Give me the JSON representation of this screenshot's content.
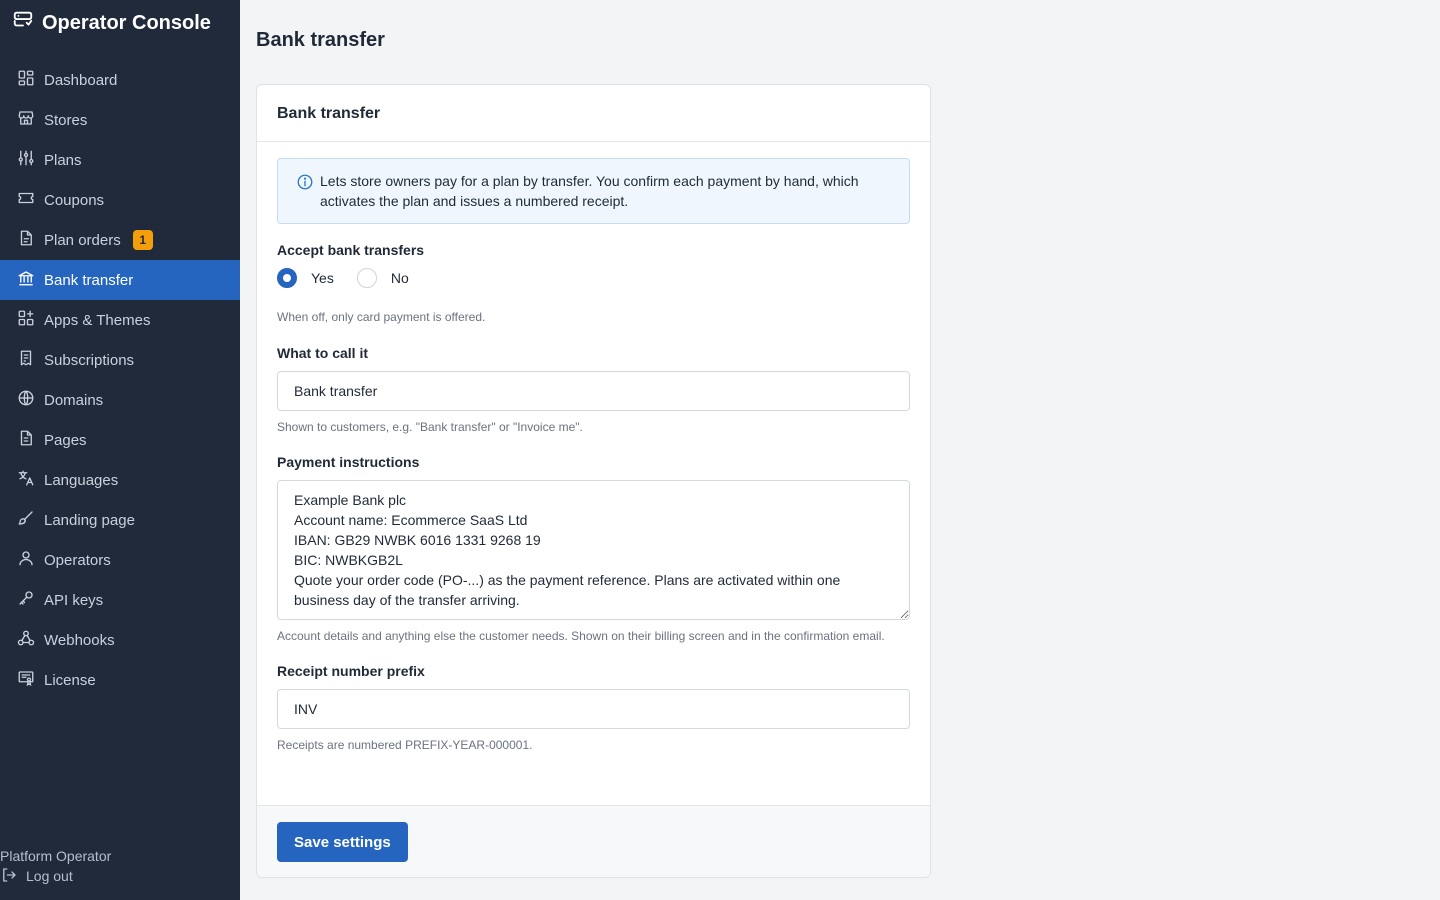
{
  "app": {
    "title": "Operator Console"
  },
  "sidebar": {
    "items": [
      {
        "label": "Dashboard",
        "icon": "dashboard-icon"
      },
      {
        "label": "Stores",
        "icon": "store-icon"
      },
      {
        "label": "Plans",
        "icon": "sliders-icon"
      },
      {
        "label": "Coupons",
        "icon": "ticket-icon"
      },
      {
        "label": "Plan orders",
        "icon": "document-icon",
        "badge": "1"
      },
      {
        "label": "Bank transfer",
        "icon": "bank-icon",
        "active": true
      },
      {
        "label": "Apps & Themes",
        "icon": "apps-icon"
      },
      {
        "label": "Subscriptions",
        "icon": "receipt-icon"
      },
      {
        "label": "Domains",
        "icon": "globe-icon"
      },
      {
        "label": "Pages",
        "icon": "page-icon"
      },
      {
        "label": "Languages",
        "icon": "language-icon"
      },
      {
        "label": "Landing page",
        "icon": "brush-icon"
      },
      {
        "label": "Operators",
        "icon": "user-icon"
      },
      {
        "label": "API keys",
        "icon": "key-icon"
      },
      {
        "label": "Webhooks",
        "icon": "webhook-icon"
      },
      {
        "label": "License",
        "icon": "certificate-icon"
      }
    ],
    "footer": {
      "operator_name": "Platform Operator",
      "logout_label": "Log out"
    }
  },
  "page": {
    "title": "Bank transfer"
  },
  "card": {
    "title": "Bank transfer",
    "info_text": "Lets store owners pay for a plan by transfer. You confirm each payment by hand, which activates the plan and issues a numbered receipt.",
    "accept": {
      "label": "Accept bank transfers",
      "options": [
        "Yes",
        "No"
      ],
      "selected": "Yes",
      "help": "When off, only card payment is offered."
    },
    "name_field": {
      "label": "What to call it",
      "value": "Bank transfer",
      "help": "Shown to customers, e.g. \"Bank transfer\" or \"Invoice me\"."
    },
    "instructions": {
      "label": "Payment instructions",
      "value": "Example Bank plc\nAccount name: Ecommerce SaaS Ltd\nIBAN: GB29 NWBK 6016 1331 9268 19\nBIC: NWBKGB2L\nQuote your order code (PO-...) as the payment reference. Plans are activated within one business day of the transfer arriving.",
      "help": "Account details and anything else the customer needs. Shown on their billing screen and in the confirmation email."
    },
    "prefix": {
      "label": "Receipt number prefix",
      "value": "INV",
      "help": "Receipts are numbered PREFIX-YEAR-000001."
    },
    "save_label": "Save settings"
  },
  "colors": {
    "sidebar_bg": "#202a3b",
    "accent": "#2565c0",
    "badge": "#f59e0b",
    "info_bg": "#eff6fd"
  }
}
